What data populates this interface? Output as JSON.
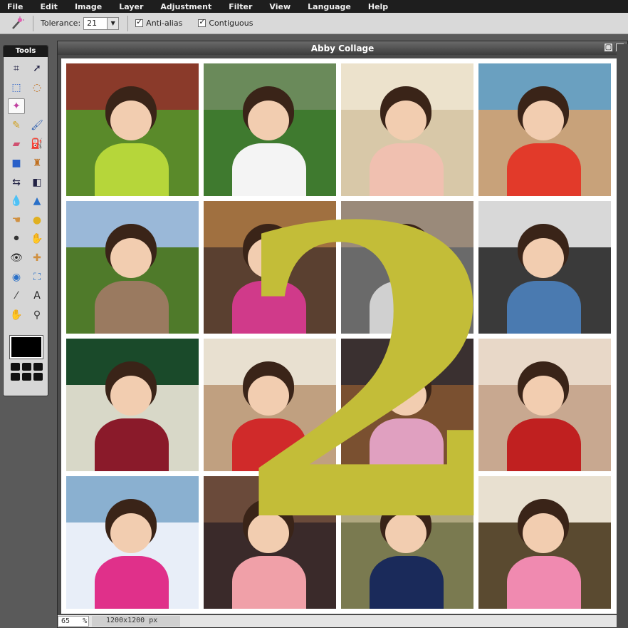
{
  "menu": [
    "File",
    "Edit",
    "Image",
    "Layer",
    "Adjustment",
    "Filter",
    "View",
    "Language",
    "Help"
  ],
  "toolbar": {
    "tolerance_label": "Tolerance:",
    "tolerance_value": "21",
    "antialias_label": "Anti-alias",
    "contiguous_label": "Contiguous"
  },
  "tools": {
    "title": "Tools",
    "items": [
      "crop-icon",
      "move-icon",
      "marquee-icon",
      "lasso-icon",
      "magic-wand-icon",
      "blank",
      "pencil-icon",
      "brush-icon",
      "eraser-icon",
      "paint-bucket-icon",
      "gradient-icon",
      "clone-stamp-icon",
      "color-replace-icon",
      "shape-icon",
      "drop-icon",
      "sharpen-icon",
      "smudge-icon",
      "sponge-icon",
      "dodge-icon",
      "burn-icon",
      "red-eye-icon",
      "spot-heal-icon",
      "bloat-icon",
      "pinch-icon",
      "color-picker-icon",
      "text-icon",
      "hand-icon",
      "zoom-icon"
    ],
    "foreground_color": "#000000"
  },
  "document": {
    "title": "Abby Collage",
    "overlay_number": "2",
    "overlay_color": "#c3bd38"
  },
  "status": {
    "zoom": "65",
    "zoom_unit": "%",
    "dimensions": "1200x1200 px"
  },
  "photos": [
    {
      "bg": "#5a8a2a",
      "top": "#8a3a2a",
      "shirt": "#b6d63a"
    },
    {
      "bg": "#3f7a2f",
      "top": "#6a8a5a",
      "shirt": "#f4f4f4"
    },
    {
      "bg": "#d8c8a8",
      "top": "#ece2cc",
      "shirt": "#f0c0b0"
    },
    {
      "bg": "#c8a27a",
      "top": "#6aa0c0",
      "shirt": "#e23a2a"
    },
    {
      "bg": "#4f7a2a",
      "top": "#9ab8d8",
      "shirt": "#9a7a60"
    },
    {
      "bg": "#5a4030",
      "top": "#a07040",
      "shirt": "#d03a8a"
    },
    {
      "bg": "#6a6a6a",
      "top": "#9a8a7a",
      "shirt": "#d0d0d0"
    },
    {
      "bg": "#3a3a3a",
      "top": "#d8d8d8",
      "shirt": "#4a7ab0"
    },
    {
      "bg": "#d8d8c8",
      "top": "#1a4a2a",
      "shirt": "#8a1a2a"
    },
    {
      "bg": "#c0a080",
      "top": "#e8e0d0",
      "shirt": "#d02a2a"
    },
    {
      "bg": "#7a5030",
      "top": "#3a3030",
      "shirt": "#e0a0c0"
    },
    {
      "bg": "#c8a890",
      "top": "#e8d8c8",
      "shirt": "#c02020"
    },
    {
      "bg": "#e8eef8",
      "top": "#8ab0d0",
      "shirt": "#e0308a"
    },
    {
      "bg": "#3a2a2a",
      "top": "#6a4a3a",
      "shirt": "#f0a0a8"
    },
    {
      "bg": "#7a7a50",
      "top": "#b0a880",
      "shirt": "#1a2a5a"
    },
    {
      "bg": "#5a4a30",
      "top": "#e8e0d0",
      "shirt": "#f08ab0"
    }
  ]
}
